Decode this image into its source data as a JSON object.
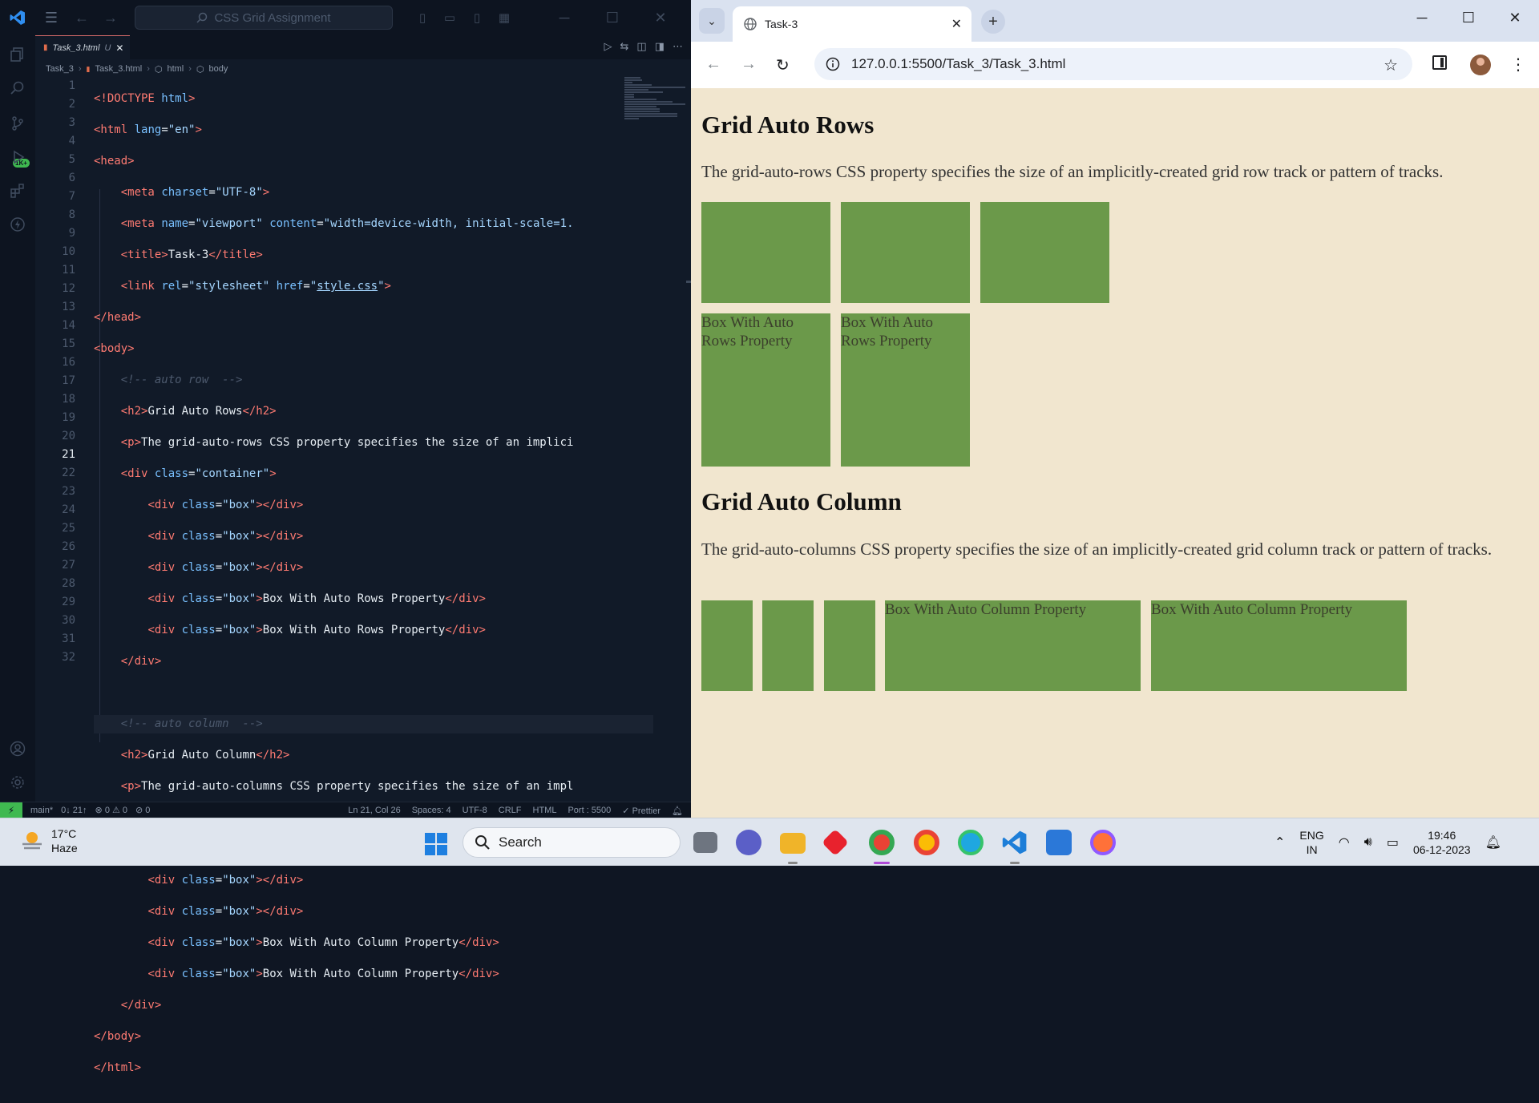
{
  "vscode": {
    "command_center": "CSS Grid Assignment",
    "tab": {
      "label": "Task_3.html",
      "modified": "U"
    },
    "breadcrumb": [
      "Task_3",
      "Task_3.html",
      "html",
      "body"
    ],
    "line_numbers": [
      "1",
      "2",
      "3",
      "4",
      "5",
      "6",
      "7",
      "8",
      "9",
      "10",
      "11",
      "12",
      "13",
      "14",
      "15",
      "16",
      "17",
      "18",
      "19",
      "20",
      "21",
      "22",
      "23",
      "24",
      "25",
      "26",
      "27",
      "28",
      "29",
      "30",
      "31",
      "32"
    ],
    "current_line": "21",
    "activity_badge": "1K+",
    "status": {
      "remote": "⚡",
      "branch": "main*",
      "sync": "0↓ 21↑",
      "problems": "⊗ 0 ⚠ 0",
      "ports": "⊘ 0",
      "cursor": "Ln 21, Col 26",
      "spaces": "Spaces: 4",
      "encoding": "UTF-8",
      "eol": "CRLF",
      "language": "HTML",
      "port": "Port : 5500",
      "prettier": "✓ Prettier"
    }
  },
  "chrome": {
    "tab_title": "Task-3",
    "url": "127.0.0.1:5500/Task_3/Task_3.html",
    "page": {
      "h2_rows": "Grid Auto Rows",
      "p_rows": "The grid-auto-rows CSS property specifies the size of an implicitly-created grid row track or pattern of tracks.",
      "box_rows_label": "Box With Auto Rows Property",
      "h2_cols": "Grid Auto Column",
      "p_cols": "The grid-auto-columns CSS property specifies the size of an implicitly-created grid column track or pattern of tracks.",
      "box_cols_label": "Box With Auto Column Property"
    }
  },
  "taskbar": {
    "temperature": "17°C",
    "weather": "Haze",
    "search_placeholder": "Search",
    "lang_top": "ENG",
    "lang_bottom": "IN",
    "time": "19:46",
    "date": "06-12-2023"
  }
}
